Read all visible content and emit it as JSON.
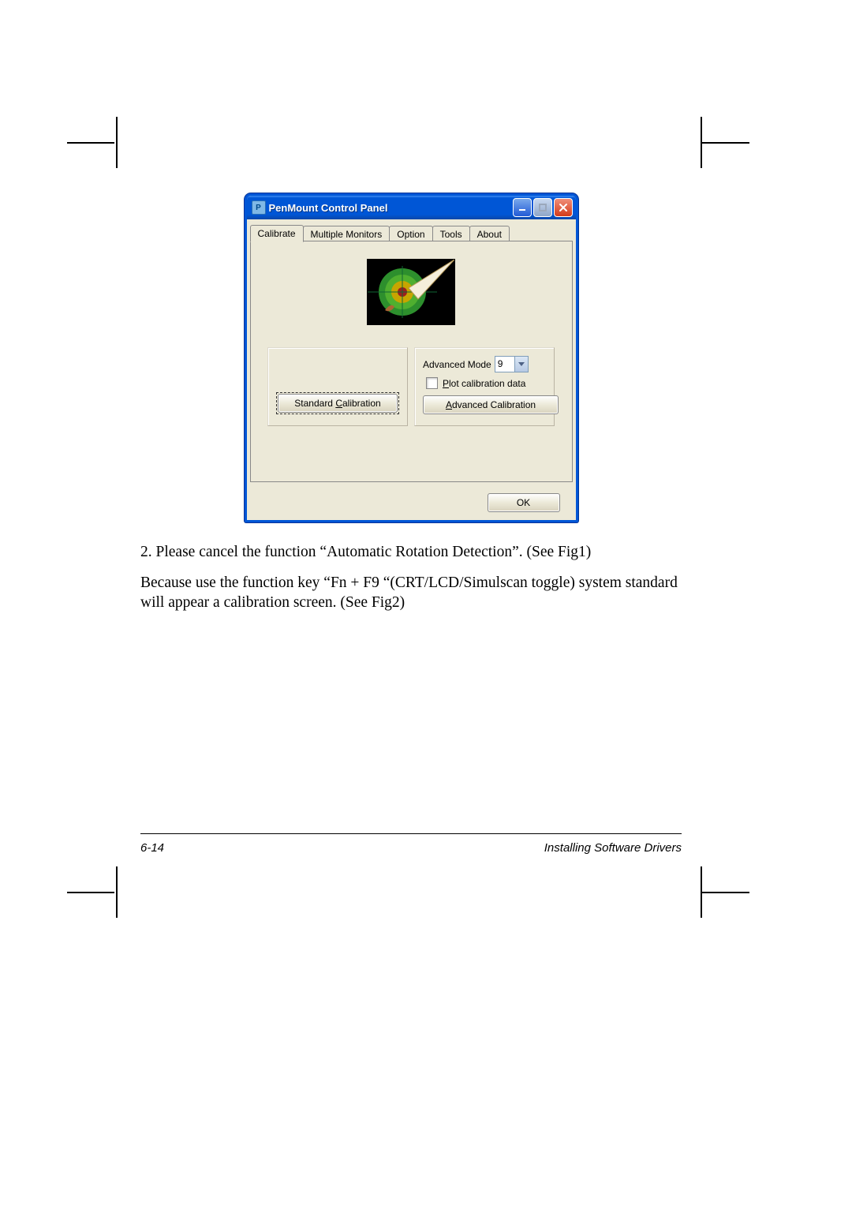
{
  "dialog": {
    "title": "PenMount Control Panel",
    "tabs": [
      "Calibrate",
      "Multiple Monitors",
      "Option",
      "Tools",
      "About"
    ],
    "active_tab_index": 0,
    "advanced_mode_label": "Advanced Mode",
    "advanced_mode_value": "9",
    "plot_checkbox_label": "Plot calibration data",
    "plot_checked": false,
    "standard_btn": "Standard Calibration",
    "advanced_btn": "Advanced Calibration",
    "ok_btn": "OK"
  },
  "body": {
    "p1": "2. Please cancel the function “Automatic Rotation Detection”. (See Fig1)",
    "p2": "Because use the function key “Fn + F9 “(CRT/LCD/Simulscan toggle) system standard will appear a calibration screen. (See Fig2)"
  },
  "footer": {
    "page": "6-14",
    "section": "Installing Software Drivers"
  }
}
